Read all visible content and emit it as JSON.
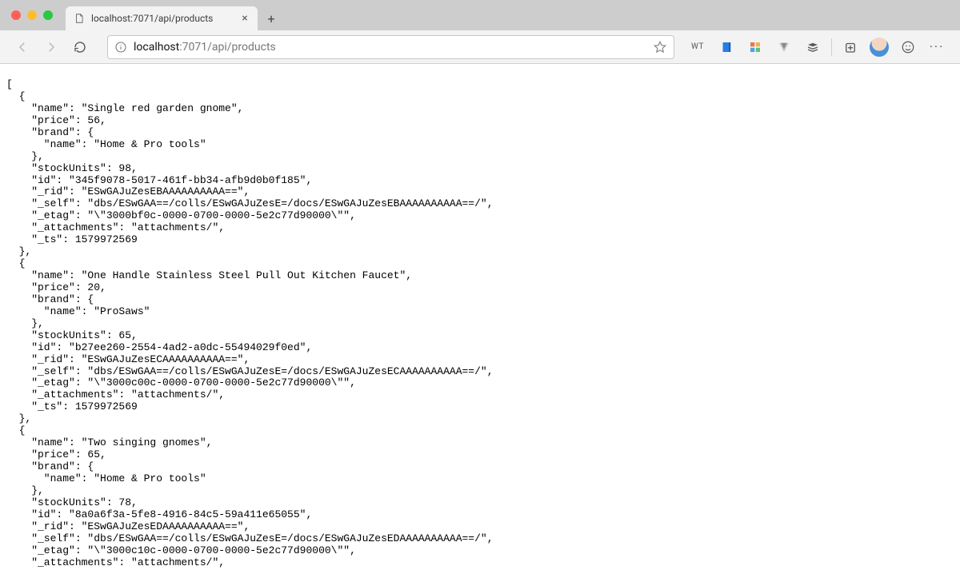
{
  "tab": {
    "title": "localhost:7071/api/products"
  },
  "address": {
    "host": "localhost",
    "path": ":7071/api/products"
  },
  "toolbar_right": {
    "wt_label": "WT"
  },
  "json_text": "[\n  {\n    \"name\": \"Single red garden gnome\",\n    \"price\": 56,\n    \"brand\": {\n      \"name\": \"Home & Pro tools\"\n    },\n    \"stockUnits\": 98,\n    \"id\": \"345f9078-5017-461f-bb34-afb9d0b0f185\",\n    \"_rid\": \"ESwGAJuZesEBAAAAAAAAAA==\",\n    \"_self\": \"dbs/ESwGAA==/colls/ESwGAJuZesE=/docs/ESwGAJuZesEBAAAAAAAAAA==/\",\n    \"_etag\": \"\\\"3000bf0c-0000-0700-0000-5e2c77d90000\\\"\",\n    \"_attachments\": \"attachments/\",\n    \"_ts\": 1579972569\n  },\n  {\n    \"name\": \"One Handle Stainless Steel Pull Out Kitchen Faucet\",\n    \"price\": 20,\n    \"brand\": {\n      \"name\": \"ProSaws\"\n    },\n    \"stockUnits\": 65,\n    \"id\": \"b27ee260-2554-4ad2-a0dc-55494029f0ed\",\n    \"_rid\": \"ESwGAJuZesECAAAAAAAAAA==\",\n    \"_self\": \"dbs/ESwGAA==/colls/ESwGAJuZesE=/docs/ESwGAJuZesECAAAAAAAAAA==/\",\n    \"_etag\": \"\\\"3000c00c-0000-0700-0000-5e2c77d90000\\\"\",\n    \"_attachments\": \"attachments/\",\n    \"_ts\": 1579972569\n  },\n  {\n    \"name\": \"Two singing gnomes\",\n    \"price\": 65,\n    \"brand\": {\n      \"name\": \"Home & Pro tools\"\n    },\n    \"stockUnits\": 78,\n    \"id\": \"8a0a6f3a-5fe8-4916-84c5-59a411e65055\",\n    \"_rid\": \"ESwGAJuZesEDAAAAAAAAAA==\",\n    \"_self\": \"dbs/ESwGAA==/colls/ESwGAJuZesE=/docs/ESwGAJuZesEDAAAAAAAAAA==/\",\n    \"_etag\": \"\\\"3000c10c-0000-0700-0000-5e2c77d90000\\\"\",\n    \"_attachments\": \"attachments/\","
}
